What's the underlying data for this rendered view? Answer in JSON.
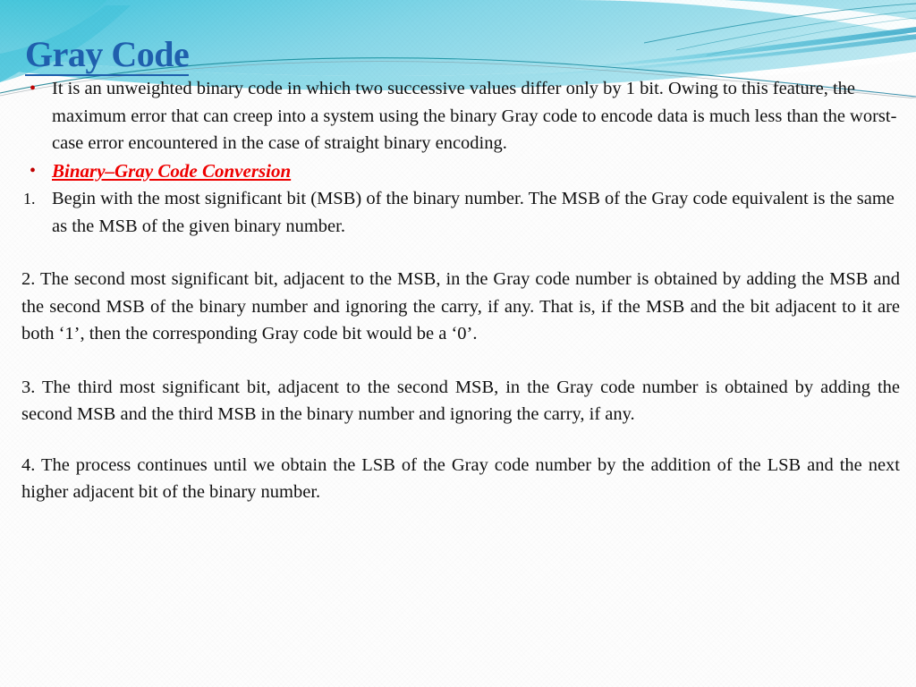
{
  "slide": {
    "title": "Gray Code",
    "title_color": "#1F5FAD",
    "accent_red": "#EE0000",
    "bullet_red": "#C00000",
    "header_gradient_from": "#49C7DC",
    "header_gradient_to": "#A8E0EC",
    "background": "#FDFDFD"
  },
  "bullets": [
    {
      "marker": "•",
      "text": "It is an unweighted binary code in which two successive values differ only by 1 bit. Owing to this feature, the maximum error that can creep into a system using the binary Gray code to encode data is much less than the worst-case error encountered in the case of straight binary encoding."
    },
    {
      "marker": "•",
      "text": "Binary–Gray Code Conversion"
    }
  ],
  "numbered": [
    {
      "marker": "1.",
      "text": "Begin with the most significant bit (MSB) of the binary number. The MSB of the Gray code equivalent is the same as the MSB of the given binary number."
    }
  ],
  "paragraphs": [
    {
      "number": "2.",
      "text": "2. The second most significant bit, adjacent to the MSB, in the Gray code number is obtained by adding the MSB and the second MSB of the binary number and ignoring the carry, if any. That is, if the MSB and the bit adjacent to it are both ‘1’, then the corresponding Gray code bit would be a ‘0’."
    },
    {
      "number": "3.",
      "text": "3. The third most significant bit, adjacent to the second MSB, in the Gray code number is obtained by adding the second MSB and the third MSB in the binary number and ignoring the carry, if any."
    },
    {
      "number": "4.",
      "text": "4. The process continues until we obtain the LSB of the Gray code number by the addition of the LSB and the next higher adjacent bit of the binary number."
    }
  ]
}
